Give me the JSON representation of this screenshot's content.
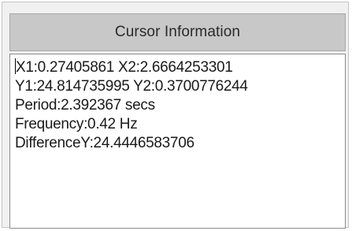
{
  "panel": {
    "title": "Cursor Information"
  },
  "cursor_info": {
    "line1": "X1:0.27405861 X2:2.6664253301",
    "line2": "Y1:24.814735995 Y2:0.3700776244",
    "line3": "Period:2.392367 secs",
    "line4": "Frequency:0.42 Hz",
    "line5": "DifferenceY:24.4446583706"
  },
  "colors": {
    "header_bg": "#c8c8c8",
    "window_bg": "#f0f0f0",
    "text_bg": "#ffffff"
  }
}
